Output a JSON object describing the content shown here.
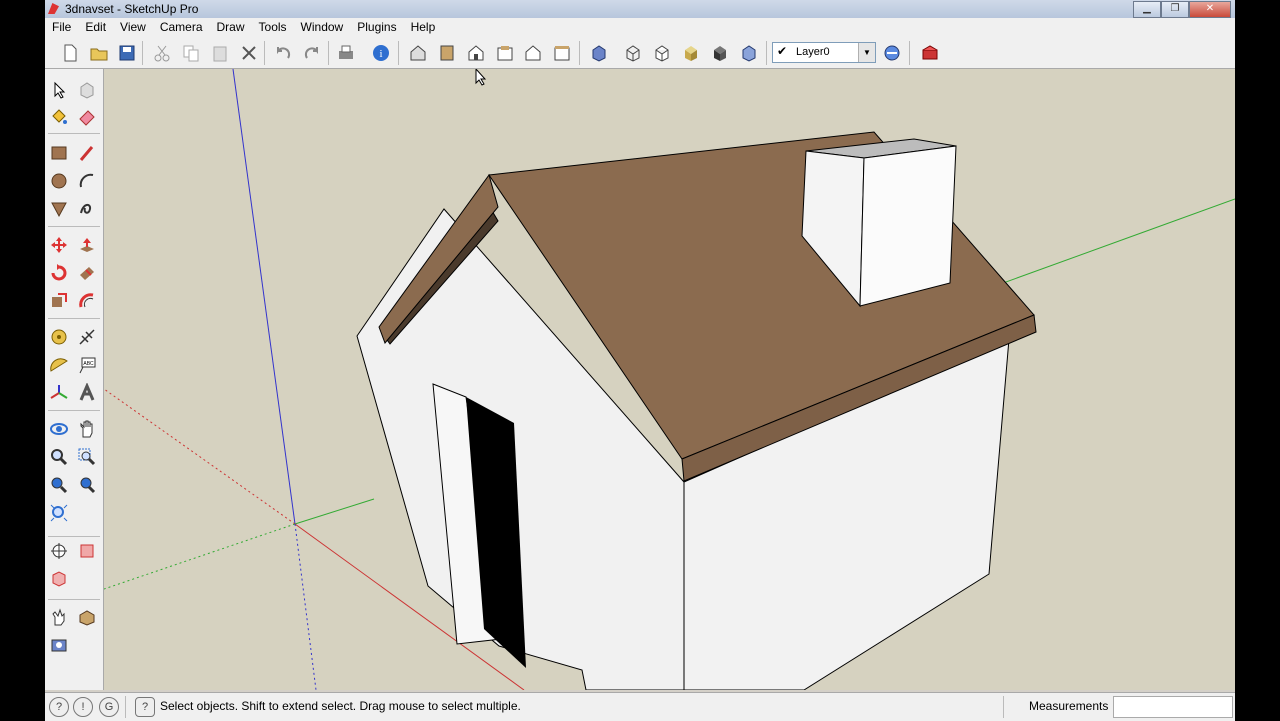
{
  "window": {
    "title": "3dnavset - SketchUp Pro"
  },
  "menu": {
    "items": [
      "File",
      "Edit",
      "View",
      "Camera",
      "Draw",
      "Tools",
      "Window",
      "Plugins",
      "Help"
    ]
  },
  "toolbar": {
    "layer": {
      "name": "Layer0",
      "checked": true
    }
  },
  "status": {
    "message": "Select objects. Shift to extend select. Drag mouse to select multiple.",
    "measurements_label": "Measurements",
    "measurements_value": ""
  },
  "colors": {
    "sky": "#d6d2c0",
    "roof": "#8b6b4f",
    "wall": "#f2f2f2",
    "door": "#000000",
    "axis_red": "#cc3333",
    "axis_green": "#33bb33",
    "axis_blue": "#3333cc"
  },
  "icons": {
    "toolbar": [
      "new-icon",
      "open-icon",
      "save-icon",
      "cut-icon",
      "copy-icon",
      "paste-icon",
      "erase-icon",
      "undo-icon",
      "redo-icon",
      "print-icon",
      "model-info-icon",
      "iso-view-icon",
      "top-view-icon",
      "front-view-icon",
      "right-view-icon",
      "back-view-icon",
      "left-view-icon",
      "xray-icon",
      "wireframe-icon",
      "hidden-line-icon",
      "shaded-icon",
      "shaded-textures-icon",
      "monochrome-icon",
      "layer-manager-icon",
      "warehouse-icon"
    ],
    "left": [
      "select-icon",
      "component-icon",
      "paint-bucket-icon",
      "eraser-icon",
      "rectangle-icon",
      "line-icon",
      "circle-icon",
      "arc-icon",
      "polygon-icon",
      "freehand-icon",
      "move-icon",
      "push-pull-icon",
      "rotate-icon",
      "follow-me-icon",
      "scale-icon",
      "offset-icon",
      "tape-measure-icon",
      "dimension-icon",
      "protractor-icon",
      "text-icon",
      "axes-icon",
      "3d-text-icon",
      "orbit-icon",
      "pan-icon",
      "zoom-icon",
      "zoom-window-icon",
      "zoom-extents-icon",
      "previous-view-icon",
      "next-view-icon",
      "position-camera-icon",
      "look-around-icon",
      "section-plane-icon",
      "walk-icon",
      "sandbox-icon",
      "photo-icon"
    ]
  }
}
